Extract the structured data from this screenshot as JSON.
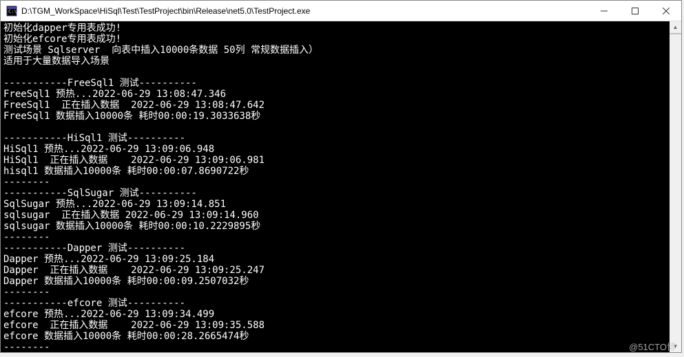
{
  "window": {
    "title": "D:\\TGM_WorkSpace\\HiSql\\Test\\TestProject\\bin\\Release\\net5.0\\TestProject.exe"
  },
  "console": {
    "lines": [
      "初始化dapper专用表成功!",
      "初始化efcore专用表成功!",
      "测试场景 Sqlserver  向表中插入10000条数据 50列 常规数据插入）",
      "适用于大量数据导入场景",
      "",
      "-----------FreeSql1 测试----------",
      "FreeSql1 预热...2022-06-29 13:08:47.346",
      "FreeSql1  正在插入数据  2022-06-29 13:08:47.642",
      "FreeSql1 数据插入10000条 耗时00:00:19.3033638秒",
      "",
      "-----------HiSql1 测试----------",
      "HiSql1 预热...2022-06-29 13:09:06.948",
      "HiSql1  正在插入数据    2022-06-29 13:09:06.981",
      "hisql1 数据插入10000条 耗时00:00:07.8690722秒",
      "--------",
      "-----------SqlSugar 测试----------",
      "SqlSugar 预热...2022-06-29 13:09:14.851",
      "sqlsugar  正在插入数据 2022-06-29 13:09:14.960",
      "sqlsugar 数据插入10000条 耗时00:00:10.2229895秒",
      "--------",
      "-----------Dapper 测试----------",
      "Dapper 预热...2022-06-29 13:09:25.184",
      "Dapper  正在插入数据    2022-06-29 13:09:25.247",
      "Dapper 数据插入10000条 耗时00:00:09.2507032秒",
      "--------",
      "-----------efcore 测试----------",
      "efcore 预热...2022-06-29 13:09:34.499",
      "efcore  正在插入数据    2022-06-29 13:09:35.588",
      "efcore 数据插入10000条 耗时00:00:28.2665474秒",
      "--------"
    ]
  },
  "watermark": "@51CTO博"
}
